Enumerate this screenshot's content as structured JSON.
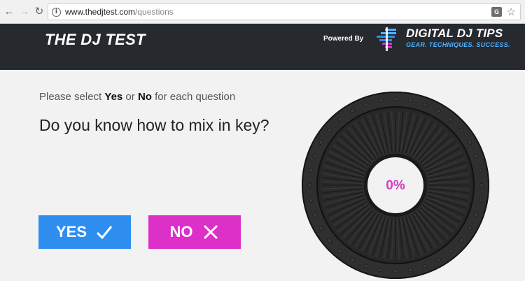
{
  "browser": {
    "url_host": "www.thedjtest.com",
    "url_path": "/questions",
    "icons": [
      "back-arrow-icon",
      "forward-arrow-icon",
      "reload-icon",
      "info-icon",
      "translate-icon",
      "star-icon"
    ]
  },
  "header": {
    "title": "THE DJ TEST",
    "powered_by": "Powered By",
    "brand_name": "DIGITAL DJ TIPS",
    "brand_tagline": "GEAR. TECHNIQUES. SUCCESS."
  },
  "quiz": {
    "instruction_prefix": "Please select ",
    "instruction_yes": "Yes",
    "instruction_or": " or ",
    "instruction_no": "No",
    "instruction_suffix": " for each question",
    "question": "Do you know how to mix in key?",
    "yes_label": "YES",
    "no_label": "NO",
    "progress_text": "0%",
    "progress_value": 0
  },
  "colors": {
    "header_bg": "#26292e",
    "yes_button": "#2e8ef0",
    "no_button": "#dc30c8",
    "progress_text": "#d23fc2",
    "brand_accent": "#4fb3ff"
  }
}
